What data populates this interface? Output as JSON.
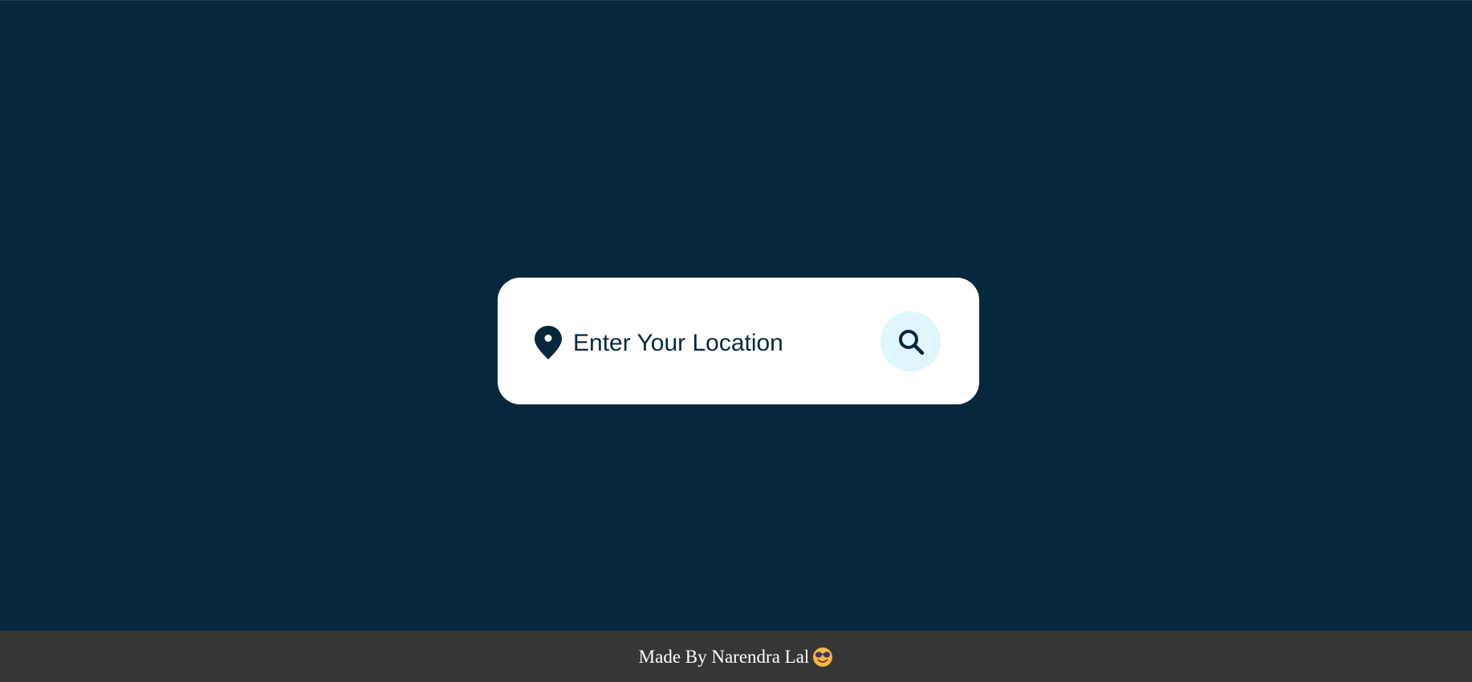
{
  "search": {
    "placeholder": "Enter Your Location",
    "value": ""
  },
  "icons": {
    "location": "location-pin-icon",
    "search": "search-icon",
    "emoji": "smiling-face-with-sunglasses-icon"
  },
  "footer": {
    "text": "Made By Narendra Lal"
  },
  "colors": {
    "background": "#06283d",
    "card": "#ffffff",
    "search_button": "#dff6ff",
    "footer": "#363636",
    "icon": "#06283d"
  }
}
